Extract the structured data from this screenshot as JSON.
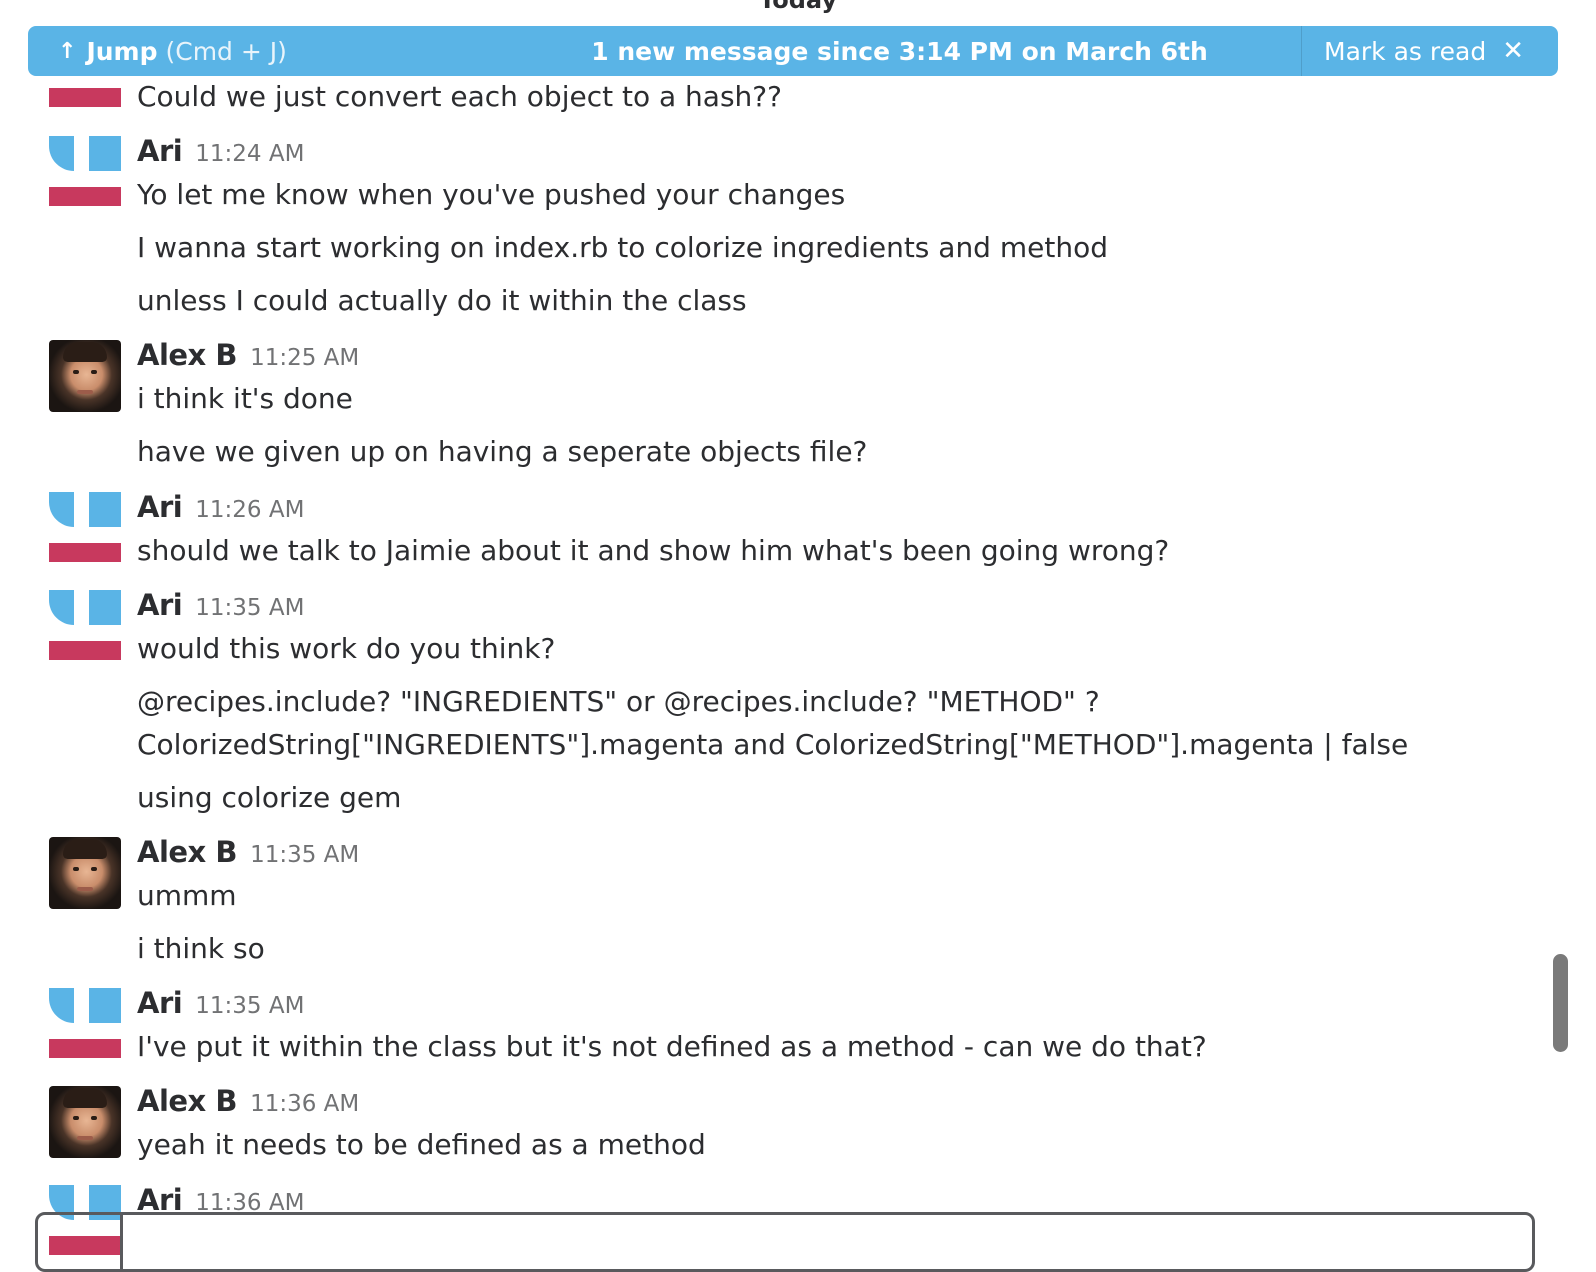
{
  "day_divider": "Today",
  "banner": {
    "jump_label": "Jump",
    "jump_hint": "(Cmd + J)",
    "new_message": "1 new message since 3:14 PM on March 6th",
    "mark_as_read": "Mark as read"
  },
  "messages": [
    {
      "text": "Could we just convert each object to a hash??"
    },
    {
      "name": "Ari",
      "time": "11:24 AM"
    },
    {
      "text": "Yo let me know when you've pushed your changes"
    },
    {
      "text": "I wanna start working on index.rb to colorize ingredients and method"
    },
    {
      "text": "unless I could actually do it within the class"
    },
    {
      "name": "Alex B",
      "time": "11:25 AM"
    },
    {
      "text": "i think it's done"
    },
    {
      "text": "have we given up on having a seperate objects file?"
    },
    {
      "name": "Ari",
      "time": "11:26 AM"
    },
    {
      "text": "should we talk to Jaimie about it and show him what's been going wrong?"
    },
    {
      "name": "Ari",
      "time": "11:35 AM"
    },
    {
      "text": "would this work do you think?"
    },
    {
      "text": "@recipes.include? \"INGREDIENTS\" or @recipes.include? \"METHOD\" ?"
    },
    {
      "text": "ColorizedString[\"INGREDIENTS\"].magenta and ColorizedString[\"METHOD\"].magenta | false"
    },
    {
      "text": "using colorize gem"
    },
    {
      "name": "Alex B",
      "time": "11:35 AM"
    },
    {
      "text": "ummm"
    },
    {
      "text": "i think so"
    },
    {
      "name": "Ari",
      "time": "11:35 AM"
    },
    {
      "text": "I've put it within the class but it's not defined as a method - can we do that?"
    },
    {
      "name": "Alex B",
      "time": "11:36 AM"
    },
    {
      "text": "yeah it needs to be defined as a method"
    },
    {
      "name": "Ari",
      "time": "11:36 AM"
    }
  ],
  "icons": {
    "jump": "up-arrow-icon",
    "close": "close-icon"
  }
}
